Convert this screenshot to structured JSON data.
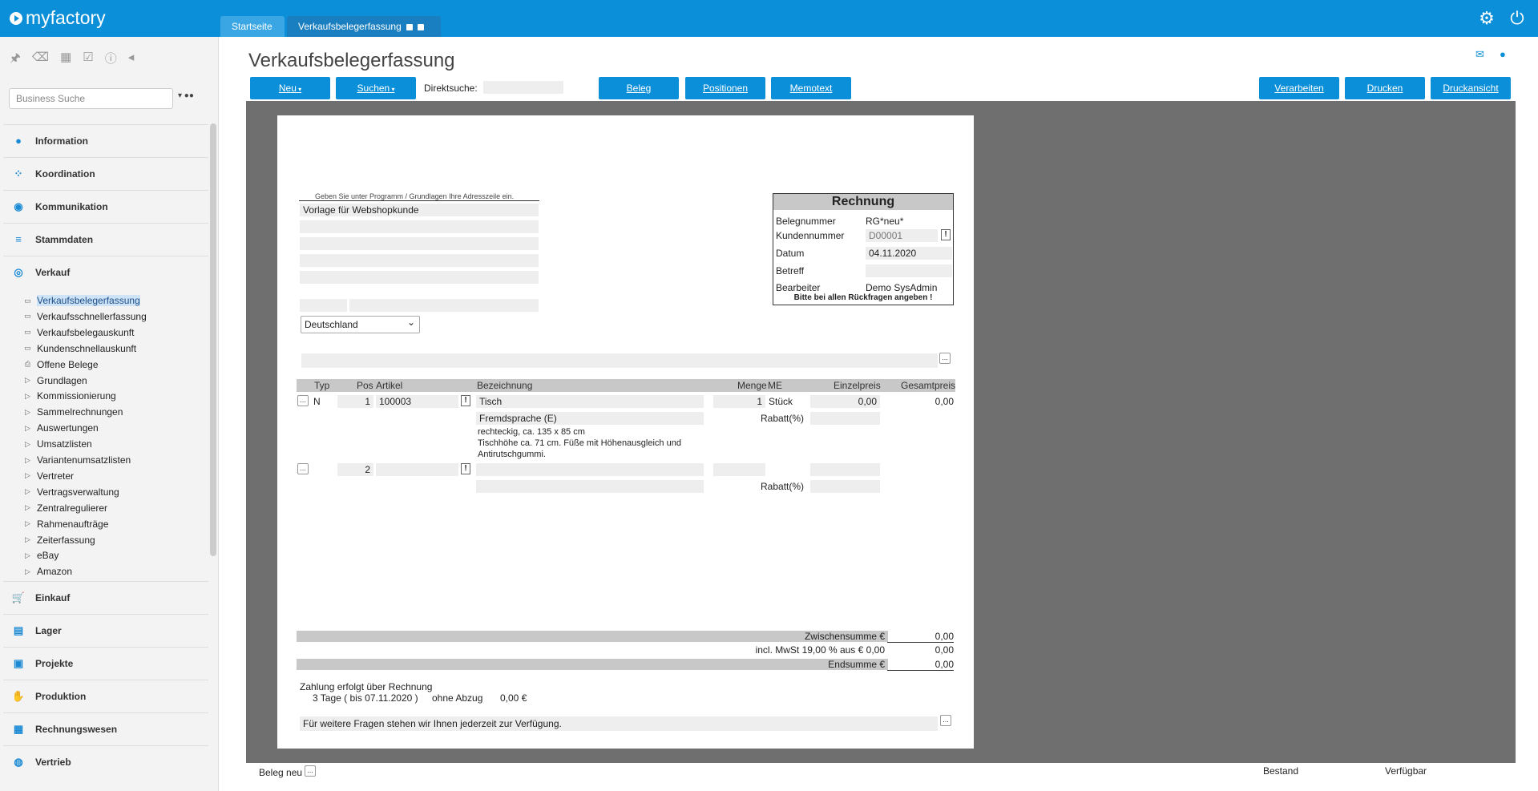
{
  "app": {
    "brand": "myfactory"
  },
  "tabs": [
    {
      "label": "Startseite"
    },
    {
      "label": "Verkaufsbelegerfassung"
    }
  ],
  "sidebar": {
    "search_placeholder": "Business Suche",
    "sections_top": [
      {
        "label": "Information",
        "icon": "info-icon"
      },
      {
        "label": "Koordination",
        "icon": "coordination-icon"
      },
      {
        "label": "Kommunikation",
        "icon": "chat-icon"
      },
      {
        "label": "Stammdaten",
        "icon": "database-icon"
      },
      {
        "label": "Verkauf",
        "icon": "coins-icon"
      }
    ],
    "verkauf_items": [
      {
        "label": "Verkaufsbelegerfassung",
        "icon": "window-icon"
      },
      {
        "label": "Verkaufsschnellerfassung",
        "icon": "window-icon"
      },
      {
        "label": "Verkaufsbelegauskunft",
        "icon": "window-icon"
      },
      {
        "label": "Kundenschnellauskunft",
        "icon": "window-icon"
      },
      {
        "label": "Offene Belege",
        "icon": "printer-icon"
      },
      {
        "label": "Grundlagen",
        "icon": "triangle-right-icon"
      },
      {
        "label": "Kommissionierung",
        "icon": "triangle-right-icon"
      },
      {
        "label": "Sammelrechnungen",
        "icon": "triangle-right-icon"
      },
      {
        "label": "Auswertungen",
        "icon": "triangle-right-icon"
      },
      {
        "label": "Umsatzlisten",
        "icon": "triangle-right-icon"
      },
      {
        "label": "Variantenumsatzlisten",
        "icon": "triangle-right-icon"
      },
      {
        "label": "Vertreter",
        "icon": "triangle-right-icon"
      },
      {
        "label": "Vertragsverwaltung",
        "icon": "triangle-right-icon"
      },
      {
        "label": "Zentralregulierer",
        "icon": "triangle-right-icon"
      },
      {
        "label": "Rahmenaufträge",
        "icon": "triangle-right-icon"
      },
      {
        "label": "Zeiterfassung",
        "icon": "triangle-right-icon"
      },
      {
        "label": "eBay",
        "icon": "triangle-right-icon"
      },
      {
        "label": "Amazon",
        "icon": "triangle-right-icon"
      }
    ],
    "sections_bottom": [
      {
        "label": "Einkauf",
        "icon": "cart-icon"
      },
      {
        "label": "Lager",
        "icon": "warehouse-icon"
      },
      {
        "label": "Projekte",
        "icon": "projects-icon"
      },
      {
        "label": "Produktion",
        "icon": "production-icon"
      },
      {
        "label": "Rechnungswesen",
        "icon": "grid-icon"
      },
      {
        "label": "Vertrieb",
        "icon": "sales-icon"
      }
    ]
  },
  "main": {
    "title": "Verkaufsbelegerfassung",
    "toolbar": {
      "neu": "Neu",
      "suchen": "Suchen",
      "direktsuche_label": "Direktsuche:",
      "beleg": "Beleg",
      "positionen": "Positionen",
      "memotext": "Memotext",
      "verarbeiten": "Verarbeiten",
      "drucken": "Drucken",
      "druckansicht": "Druckansicht"
    }
  },
  "document": {
    "address_hint": "Geben Sie unter Programm / Grundlagen Ihre Adresszeile ein.",
    "address_line1": "Vorlage für Webshopkunde",
    "country": "Deutschland",
    "invoice": {
      "title": "Rechnung",
      "belegnummer_label": "Belegnummer",
      "belegnummer": "RG*neu*",
      "kundennummer_label": "Kundennummer",
      "kundennummer": "D00001",
      "datum_label": "Datum",
      "datum": "04.11.2020",
      "betreff_label": "Betreff",
      "bearbeiter_label": "Bearbeiter",
      "bearbeiter": "Demo SysAdmin",
      "note": "Bitte bei allen Rückfragen angeben !"
    },
    "table_headers": {
      "typ": "Typ",
      "pos": "Pos",
      "artikel": "Artikel",
      "bezeichnung": "Bezeichnung",
      "menge": "Menge",
      "me": "ME",
      "einzelpreis": "Einzelpreis",
      "gesamtpreis": "Gesamtpreis"
    },
    "rows": [
      {
        "typ": "N",
        "pos": "1",
        "artikel": "100003",
        "bezeichnung": "Tisch",
        "menge": "1",
        "me": "Stück",
        "einzelpreis": "0,00",
        "gesamtpreis": "0,00",
        "bezeichnung2": "Fremdsprache (E)",
        "rabatt_label": "Rabatt(%)",
        "desc1": "rechteckig, ca. 135 x 85 cm",
        "desc2": "Tischhöhe ca. 71 cm. Füße mit Höhenausgleich und",
        "desc3": "Antirutschgummi."
      },
      {
        "pos": "2",
        "rabatt_label": "Rabatt(%)"
      }
    ],
    "totals": {
      "zwischensumme_label": "Zwischensumme €",
      "zwischensumme": "0,00",
      "mwst_label": "incl. MwSt 19,00 % aus € 0,00",
      "mwst": "0,00",
      "endsumme_label": "Endsumme €",
      "endsumme": "0,00"
    },
    "payment": {
      "line1": "Zahlung erfolgt über Rechnung",
      "days": "3 Tage ( bis 07.11.2020 )",
      "abzug": "ohne Abzug",
      "amount": "0,00 €"
    },
    "footer_text": "Für weitere Fragen stehen wir Ihnen jederzeit zur Verfügung."
  },
  "statusbar": {
    "beleg_neu": "Beleg neu",
    "bestand": "Bestand",
    "verfuegbar": "Verfügbar"
  }
}
